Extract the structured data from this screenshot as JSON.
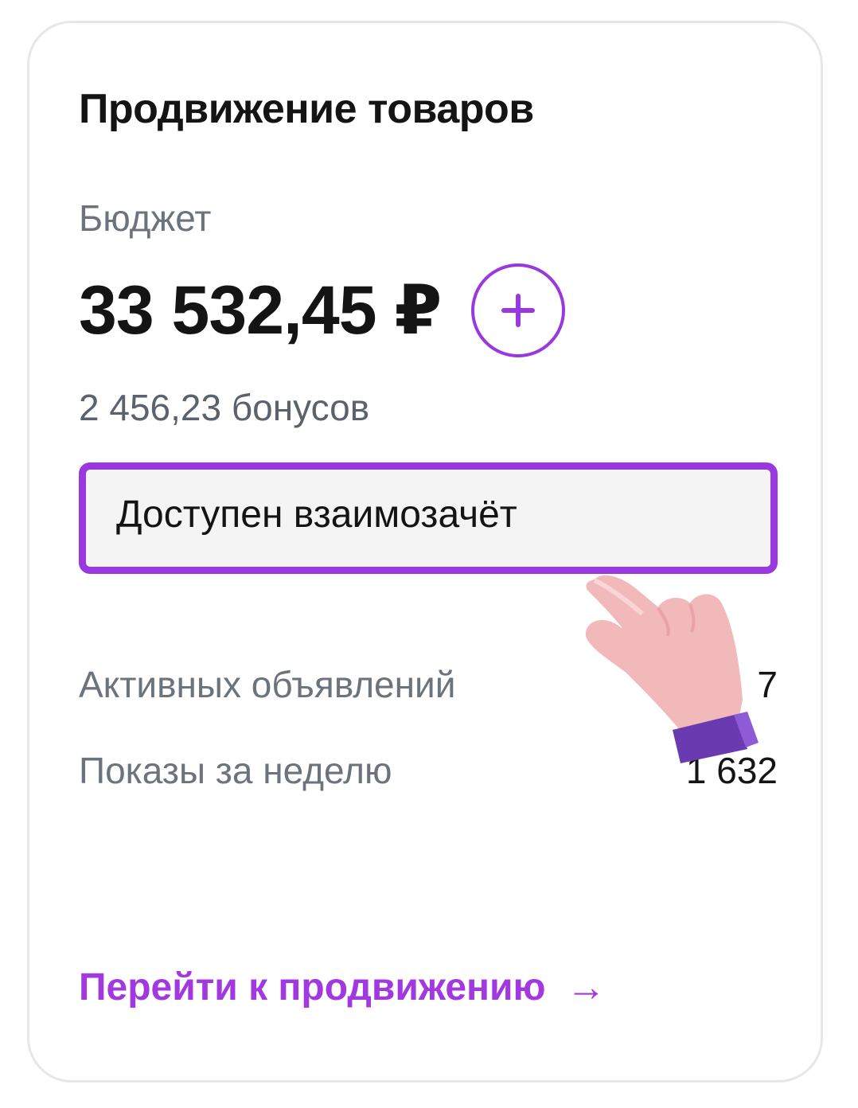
{
  "card": {
    "title": "Продвижение товаров",
    "budget_label": "Бюджет",
    "budget_amount": "33 532,45 ₽",
    "bonus": "2 456,23 бонусов",
    "offset_button_label": "Доступен взаимозачёт",
    "stats": [
      {
        "label": "Активных объявлений",
        "value": "7"
      },
      {
        "label": "Показы за неделю",
        "value": "1 632"
      }
    ],
    "link_label": "Перейти к продвижению",
    "link_arrow": "→"
  },
  "icons": {
    "add": "plus-icon",
    "link_arrow": "arrow-right-icon",
    "pointer": "hand-pointer-icon"
  },
  "colors": {
    "accent": "#9a38e0",
    "link": "#a238e0",
    "text": "#141414",
    "secondary_text": "#6b747d",
    "button_bg": "#f4f4f5"
  }
}
